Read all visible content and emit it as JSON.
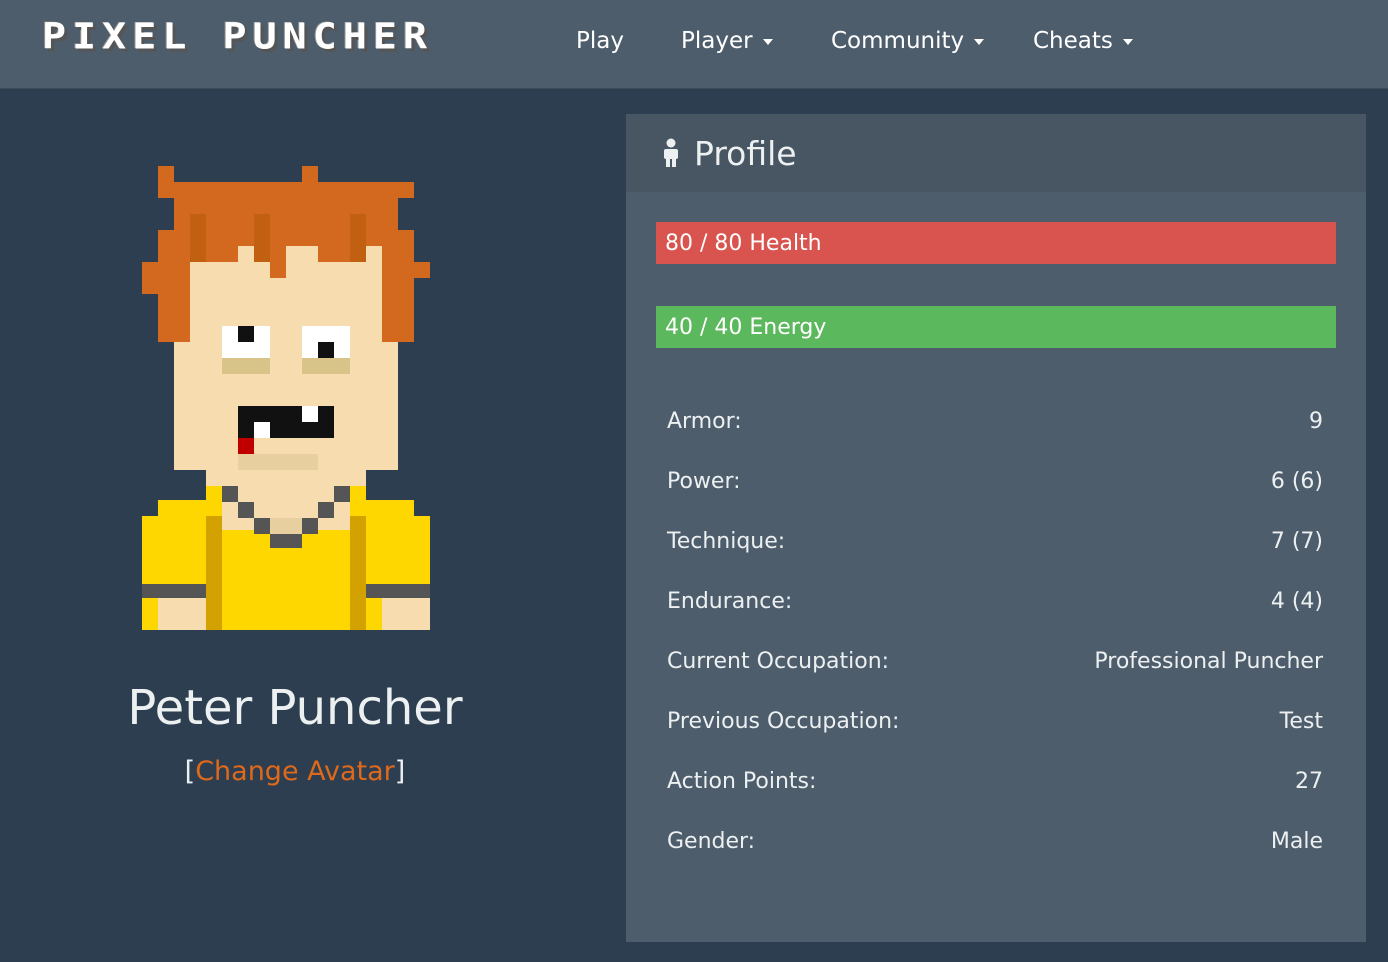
{
  "brand": "PIXEL PUNCHER",
  "nav": {
    "play": "Play",
    "player": "Player",
    "community": "Community",
    "cheats": "Cheats"
  },
  "player": {
    "name": "Peter Puncher",
    "change_avatar_open": "[",
    "change_avatar_label": "Change Avatar",
    "change_avatar_close": "]"
  },
  "panel": {
    "title": "Profile",
    "health": {
      "current": 80,
      "max": 80,
      "label": "80 / 80 Health",
      "fraction": 1.0,
      "color": "#d9534f"
    },
    "energy": {
      "current": 40,
      "max": 40,
      "label": "40 / 40 Energy",
      "fraction": 1.0,
      "color": "#5cb85c"
    },
    "stats": [
      {
        "label": "Armor:",
        "value": "9"
      },
      {
        "label": "Power:",
        "value": "6 (6)"
      },
      {
        "label": "Technique:",
        "value": "7 (7)"
      },
      {
        "label": "Endurance:",
        "value": "4 (4)"
      },
      {
        "label": "Current Occupation:",
        "value": "Professional Puncher"
      },
      {
        "label": "Previous Occupation:",
        "value": "Test"
      },
      {
        "label": "Action Points:",
        "value": "27"
      },
      {
        "label": "Gender:",
        "value": "Male"
      }
    ]
  },
  "colors": {
    "background": "#2c3e50",
    "navbar": "#4e5d6c",
    "panel": "#4e5d6c",
    "panel_heading": "#485563",
    "link": "#df691a"
  }
}
